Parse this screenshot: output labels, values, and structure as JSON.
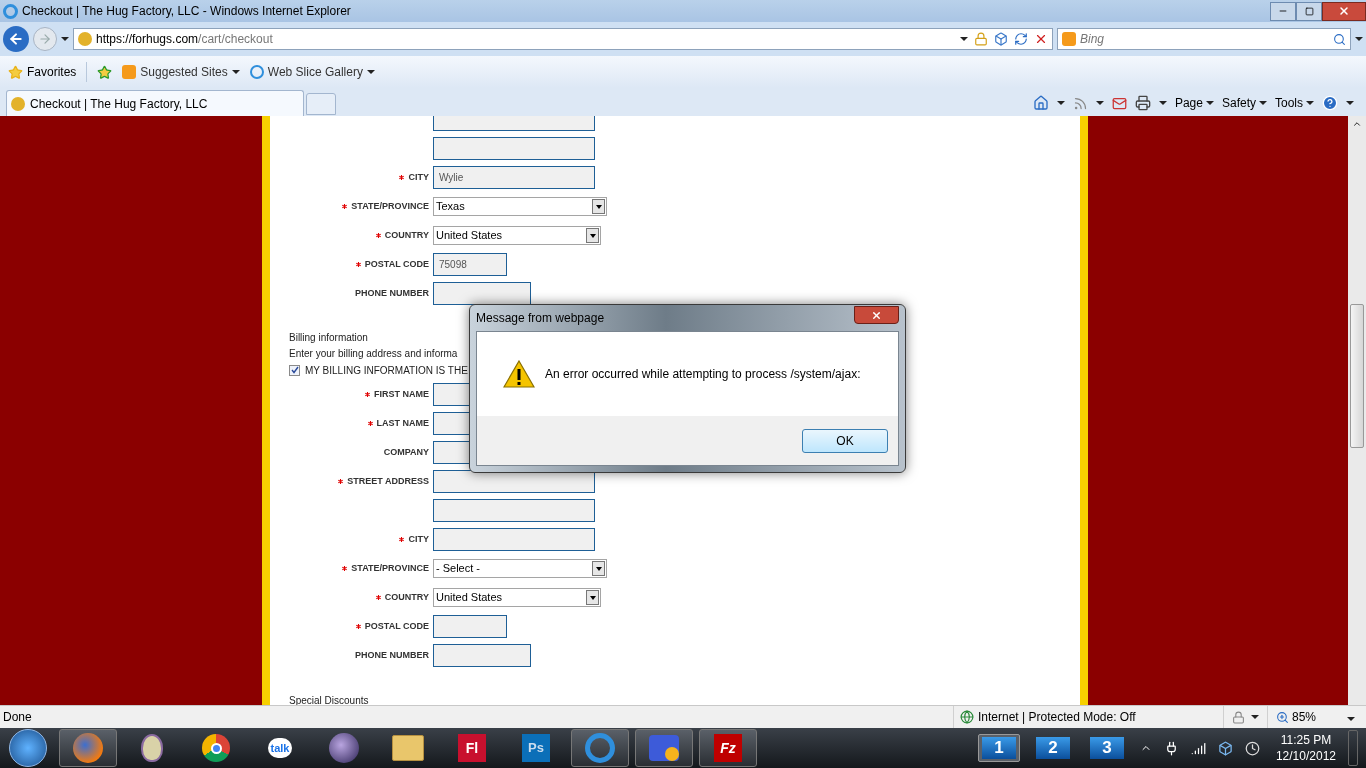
{
  "window": {
    "title": "Checkout | The Hug Factory, LLC - Windows Internet Explorer"
  },
  "address_bar": {
    "host": "https://forhugs.com",
    "path": "/cart/checkout"
  },
  "search": {
    "placeholder": "Bing"
  },
  "favorites_bar": {
    "favorites": "Favorites",
    "links": [
      "Suggested Sites",
      "Web Slice Gallery"
    ]
  },
  "tabs": [
    {
      "label": "Checkout | The Hug Factory, LLC",
      "selected": true
    }
  ],
  "command_bar": [
    "Page",
    "Safety",
    "Tools"
  ],
  "shipping_fields": [
    {
      "kind": "text",
      "required": false
    },
    {
      "kind": "text",
      "required": false
    },
    {
      "kind": "text",
      "label": "CITY",
      "required": true,
      "value": "Wylie"
    },
    {
      "kind": "select",
      "label": "STATE/PROVINCE",
      "required": true,
      "value": "Texas"
    },
    {
      "kind": "select",
      "label": "COUNTRY",
      "required": true,
      "value": "United States"
    },
    {
      "kind": "postal",
      "label": "POSTAL CODE",
      "required": true,
      "value": "75098"
    },
    {
      "kind": "phone",
      "label": "PHONE NUMBER",
      "required": false
    }
  ],
  "billing": {
    "title": "Billing information",
    "intro": "Enter your billing address and informa",
    "same_as_shipping": {
      "label": "MY BILLING INFORMATION IS THE",
      "checked": true
    },
    "fields": [
      {
        "kind": "text",
        "label": "FIRST NAME",
        "required": true
      },
      {
        "kind": "text",
        "label": "LAST NAME",
        "required": true
      },
      {
        "kind": "text",
        "label": "COMPANY",
        "required": false
      },
      {
        "kind": "text",
        "label": "STREET ADDRESS",
        "required": true
      },
      {
        "kind": "text",
        "required": false
      },
      {
        "kind": "text",
        "label": "CITY",
        "required": true
      },
      {
        "kind": "select",
        "label": "STATE/PROVINCE",
        "required": true,
        "value": "- Select -"
      },
      {
        "kind": "select",
        "label": "COUNTRY",
        "required": true,
        "value": "United States"
      },
      {
        "kind": "postal",
        "label": "POSTAL CODE",
        "required": true
      },
      {
        "kind": "phone",
        "label": "PHONE NUMBER",
        "required": false
      }
    ]
  },
  "special_discounts": {
    "title": "Special Discounts"
  },
  "dialog": {
    "title": "Message from webpage",
    "message": "An error occurred while attempting to process /system/ajax:",
    "button": "OK"
  },
  "status_bar": {
    "text": "Done",
    "zone": "Internet | Protected Mode: Off",
    "zoom": "85%"
  },
  "taskbar": {
    "apps": [
      {
        "kind": "firefox",
        "running": true
      },
      {
        "kind": "tor",
        "running": false
      },
      {
        "kind": "chrome",
        "running": false
      },
      {
        "kind": "talk",
        "label": "talk",
        "running": false
      },
      {
        "kind": "eclipse",
        "running": false
      },
      {
        "kind": "folder",
        "running": false
      },
      {
        "kind": "flash",
        "label": "Fl",
        "running": false
      },
      {
        "kind": "photoshop",
        "label": "Ps",
        "running": false
      },
      {
        "kind": "ie",
        "running": true
      },
      {
        "kind": "chat",
        "running": true
      },
      {
        "kind": "filezilla",
        "label": "Fz",
        "running": true
      }
    ],
    "desktops": [
      {
        "label": "1",
        "selected": true
      },
      {
        "label": "2",
        "selected": false
      },
      {
        "label": "3",
        "selected": false
      }
    ],
    "time": "11:25 PM",
    "date": "12/10/2012"
  }
}
